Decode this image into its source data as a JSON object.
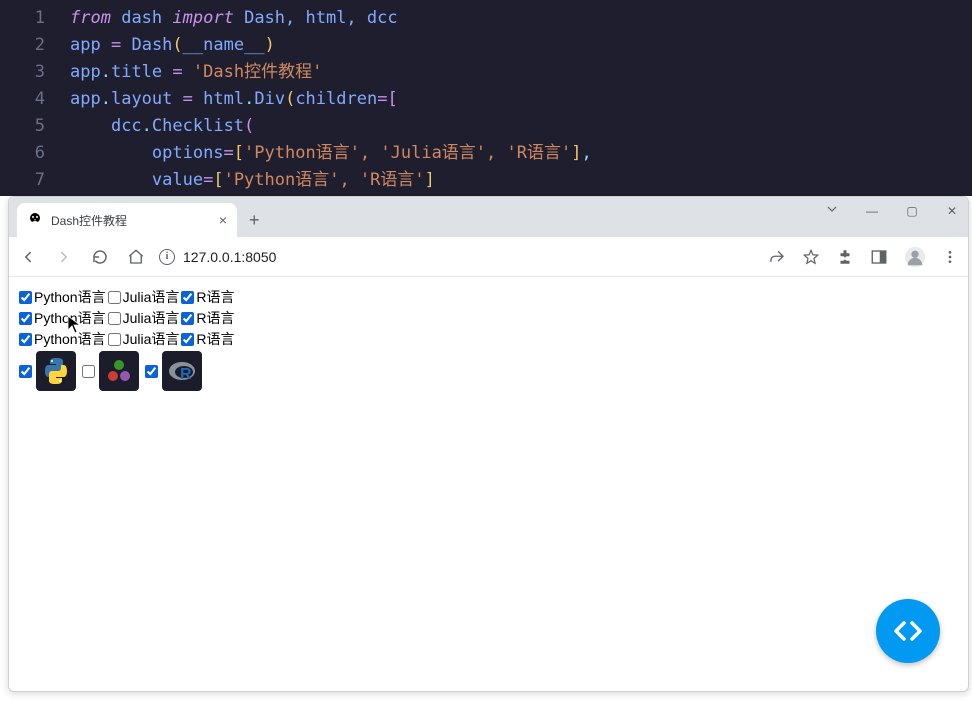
{
  "editor": {
    "lines": [
      {
        "n": "1"
      },
      {
        "n": "2"
      },
      {
        "n": "3"
      },
      {
        "n": "4"
      },
      {
        "n": "5"
      },
      {
        "n": "6"
      },
      {
        "n": "7"
      }
    ]
  },
  "browser": {
    "tab_title": "Dash控件教程",
    "url": "127.0.0.1:8050"
  },
  "checklists": {
    "rows": [
      {
        "items": [
          {
            "label": "Python语言",
            "checked": true
          },
          {
            "label": "Julia语言",
            "checked": false
          },
          {
            "label": "R语言",
            "checked": true
          }
        ]
      },
      {
        "items": [
          {
            "label": "Python语言",
            "checked": true
          },
          {
            "label": "Julia语言",
            "checked": false
          },
          {
            "label": "R语言",
            "checked": true
          }
        ]
      },
      {
        "items": [
          {
            "label": "Python语言",
            "checked": true
          },
          {
            "label": "Julia语言",
            "checked": false
          },
          {
            "label": "R语言",
            "checked": true
          }
        ]
      }
    ],
    "icons": [
      {
        "name": "python",
        "checked": true
      },
      {
        "name": "julia",
        "checked": false
      },
      {
        "name": "r",
        "checked": true
      }
    ]
  },
  "code": {
    "l1_from": "from",
    "l1_dash": "dash",
    "l1_import": "import",
    "l1_items": "Dash, html, dcc",
    "l2_app": "app",
    "l2_dash": "Dash",
    "l2_name": "__name__",
    "l3_app": "app",
    "l3_title": "title",
    "l3_str": "'Dash控件教程'",
    "l4_app": "app",
    "l4_layout": "layout",
    "l4_html": "html",
    "l4_div": "Div",
    "l4_children": "children",
    "l5_dcc": "dcc",
    "l5_checklist": "Checklist",
    "l6_options": "options",
    "l6_vals": "'Python语言', 'Julia语言', 'R语言'",
    "l7_value": "value",
    "l7_vals": "'Python语言', 'R语言'"
  }
}
